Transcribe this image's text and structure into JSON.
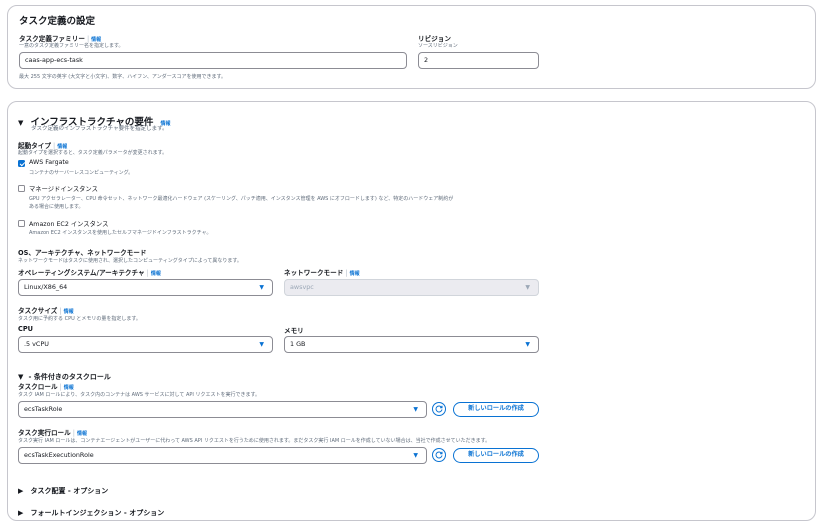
{
  "task_def": {
    "title": "タスク定義の設定",
    "family_label": "タスク定義ファミリー",
    "family_info": "情報",
    "family_desc": "一意のタスク定義ファミリー名を指定します。",
    "family_value": "caas-app-ecs-task",
    "family_hint": "最大 255 文字の英字 (大文字と小文字)、数字、ハイフン、アンダースコアを使用できます。",
    "revision_label": "リビジョン",
    "revision_desc": "ソースリビジョン",
    "revision_value": "2"
  },
  "infra": {
    "title": "インフラストラクチャの要件",
    "info": "情報",
    "desc": "タスク定義のインフラストラクチャ要件を指定します。",
    "launch_label": "起動タイプ",
    "launch_info": "情報",
    "launch_desc": "起動タイプを選択すると、タスク定義パラメータが変更されます。",
    "launch_options": [
      {
        "label": "AWS Fargate",
        "desc": "コンテナのサーバーレスコンピューティング。",
        "checked": true
      },
      {
        "label": "マネージドインスタンス",
        "desc1": "GPU アクセラレーター、CPU 命令セット、ネットワーク最適化ハードウェア (スケーリング、パッチ適用、インスタンス管理を AWS にオフロードします) など、特定のハードウェア制約が",
        "desc2": "ある場合に使用します。",
        "checked": false
      },
      {
        "label": "Amazon EC2 インスタンス",
        "desc": "Amazon EC2 インスタンスを使用したセルフマネージドインフラストラクチャ。",
        "checked": false
      }
    ],
    "os_section_label": "OS、アーキテクチャ、ネットワークモード",
    "os_section_desc": "ネットワークモードはタスクに使用され、選択したコンピューティングタイプによって異なります。",
    "os_label": "オペレーティングシステム/アーキテクチャ",
    "os_info": "情報",
    "os_value": "Linux/X86_64",
    "net_label": "ネットワークモード",
    "net_info": "情報",
    "net_value": "awsvpc",
    "size_label": "タスクサイズ",
    "size_info": "情報",
    "size_desc": "タスク用に予約する CPU とメモリの量を指定します。",
    "cpu_label": "CPU",
    "cpu_value": ".5 vCPU",
    "mem_label": "メモリ",
    "mem_value": "1 GB",
    "roles_title": "- 条件付きのタスクロール",
    "task_role_label": "タスクロール",
    "task_role_info": "情報",
    "task_role_desc": "タスク IAM ロールにより、タスク内のコンテナは AWS サービスに対して API リクエストを実行できます。",
    "task_role_value": "ecsTaskRole",
    "exec_role_label": "タスク実行ロール",
    "exec_role_info": "情報",
    "exec_role_desc": "タスク実行 IAM ロールは、コンテナエージェントがユーザーに代わって AWS API リクエストを行うために使用されます。まだタスク実行 IAM ロールを作成していない場合は、当社で作成させていただきます。",
    "exec_role_value": "ecsTaskExecutionRole",
    "create_role_label": "新しいロールの作成",
    "placement_label": "タスク配置 - オプション",
    "fault_label": "フォールトインジェクション - オプション"
  },
  "colors": {
    "accent": "#0972d3",
    "border": "#c6c6cd",
    "muted": "#5f6b7a"
  }
}
